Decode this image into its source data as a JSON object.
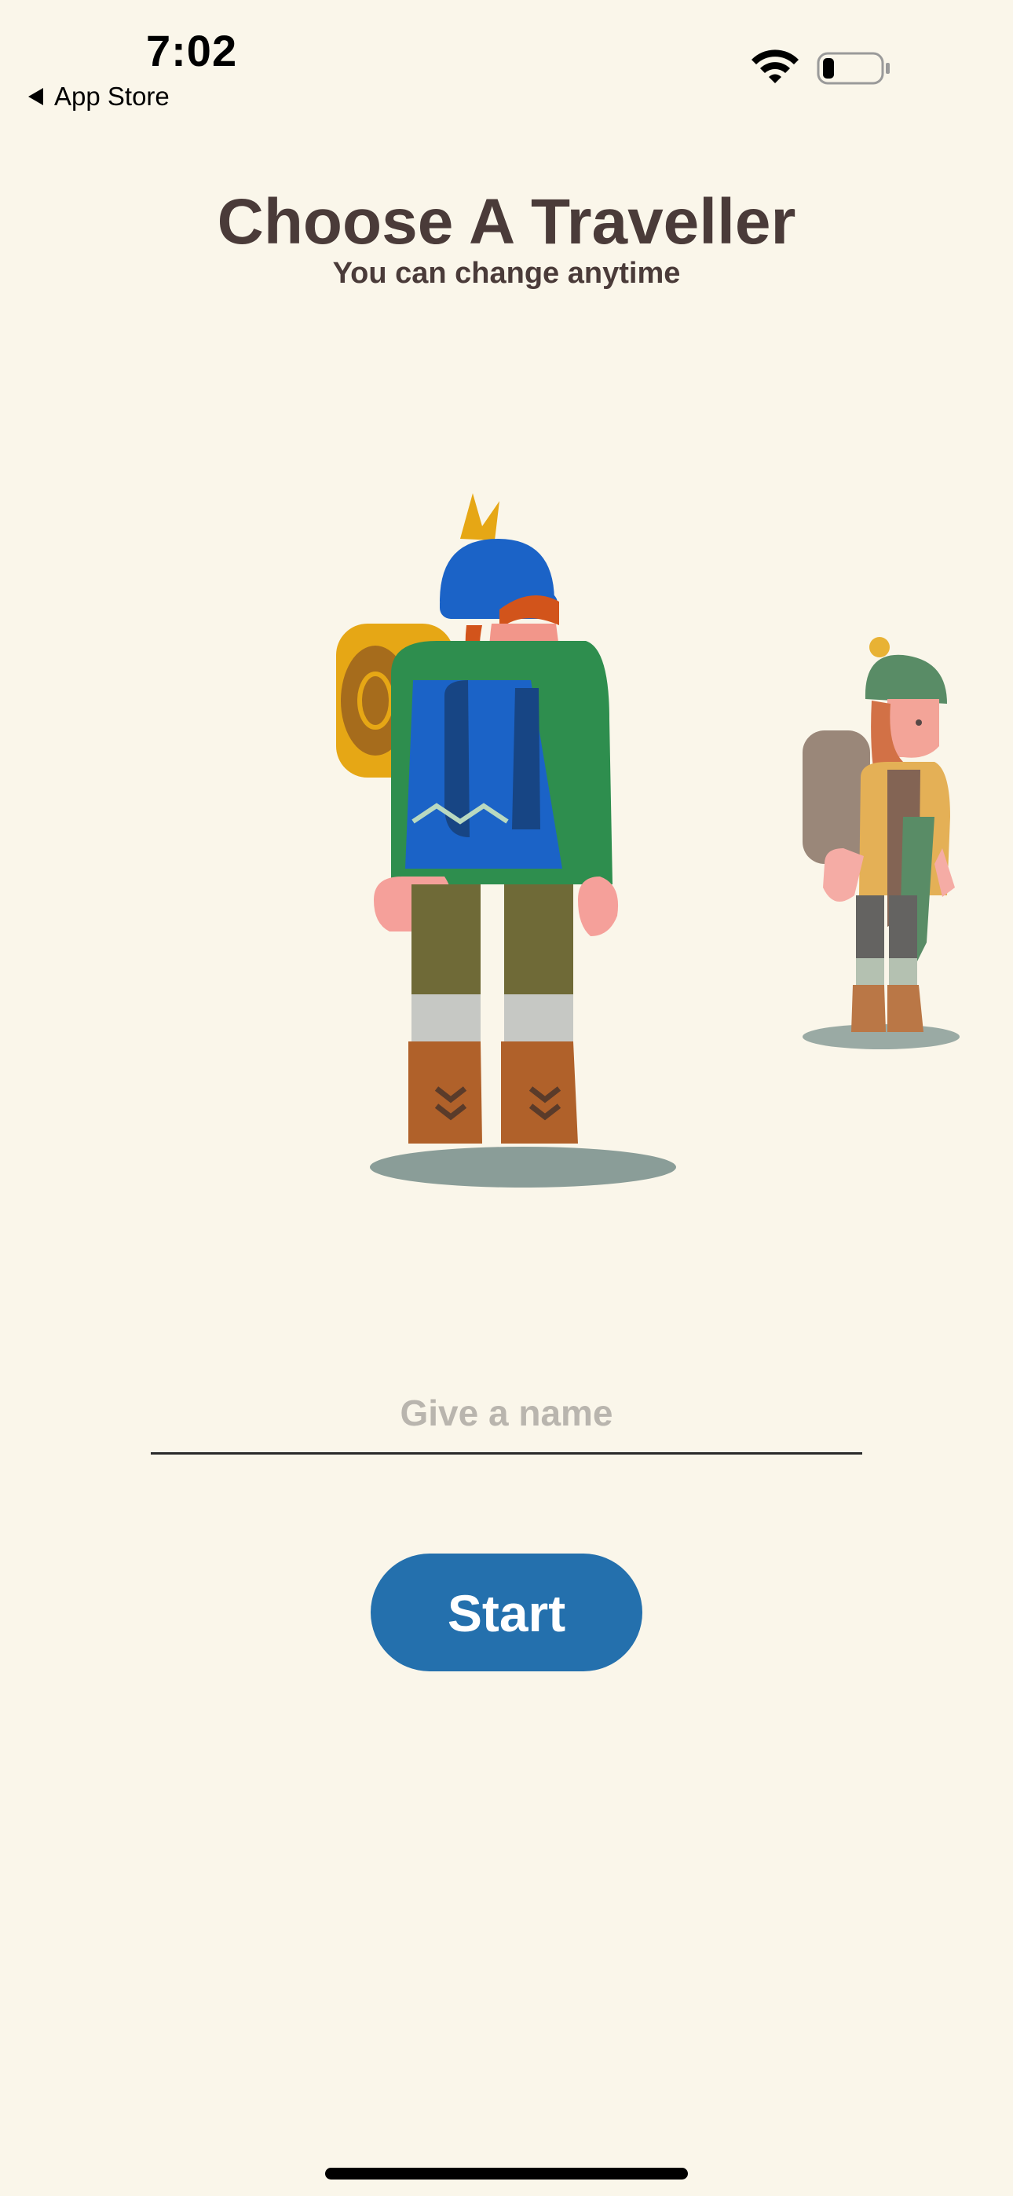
{
  "status_bar": {
    "time": "7:02",
    "back_label": "App Store",
    "wifi_icon": "wifi-icon",
    "battery_icon": "battery-low-icon"
  },
  "header": {
    "title": "Choose A Traveller",
    "subtitle": "You can change anytime"
  },
  "characters": {
    "selected": "hiker-blue-beanie",
    "next": "hiker-green-beanie"
  },
  "name_input": {
    "value": "",
    "placeholder": "Give a name"
  },
  "start_button": {
    "label": "Start",
    "color": "#2470ad"
  },
  "colors": {
    "background": "#faf6ea",
    "title_text": "#4a3b39",
    "placeholder_text": "#b9b5ae"
  }
}
